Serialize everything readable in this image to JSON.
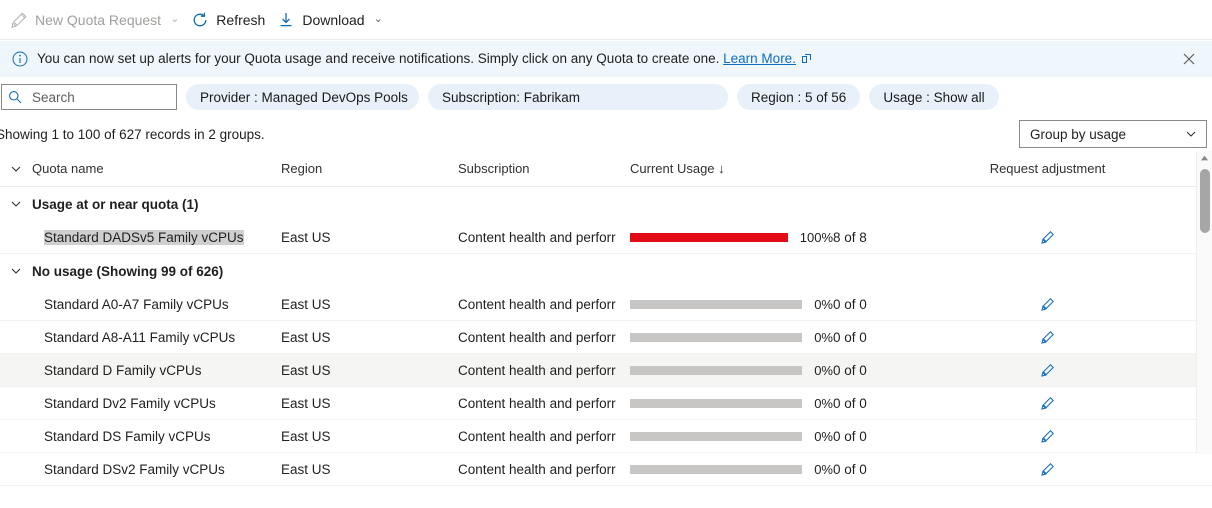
{
  "toolbar": {
    "new_quota_request": "New Quota Request",
    "refresh": "Refresh",
    "download": "Download"
  },
  "banner": {
    "text": "You can now set up alerts for your Quota usage and receive notifications. Simply click on any Quota to create one.",
    "link": "Learn More.",
    "background": "#eff6fc",
    "accent": "#0f6cbd"
  },
  "filters": {
    "search_placeholder": "Search",
    "search_value": "",
    "pills": [
      {
        "label": "Provider : Managed DevOps Pools"
      },
      {
        "label": "Subscription: Fabrikam"
      },
      {
        "label": "Region : 5 of 56"
      },
      {
        "label": "Usage : Show all"
      }
    ]
  },
  "meta": {
    "records": "Showing 1 to 100 of 627 records in 2 groups.",
    "group_by": "Group by usage"
  },
  "table": {
    "columns": {
      "quota_name": "Quota name",
      "region": "Region",
      "subscription": "Subscription",
      "current_usage": "Current Usage",
      "sort_indicator": "↓",
      "request_adjustment": "Request adjustment"
    },
    "groups": [
      {
        "title": "Usage at or near quota (1)",
        "rows": [
          {
            "name": "Standard DADSv5 Family vCPUs",
            "region": "East US",
            "subscription": "Content health and perforr",
            "percent": "100%",
            "percent_value": 100,
            "count": "8 of 8",
            "bar_color": "#e30b16",
            "selected": true,
            "hovered": false
          }
        ]
      },
      {
        "title": "No usage (Showing 99 of 626)",
        "rows": [
          {
            "name": "Standard A0-A7 Family vCPUs",
            "region": "East US",
            "subscription": "Content health and perforr",
            "percent": "0%",
            "percent_value": 0,
            "count": "0 of 0",
            "bar_color": "#c8c6c4",
            "selected": false,
            "hovered": false
          },
          {
            "name": "Standard A8-A11 Family vCPUs",
            "region": "East US",
            "subscription": "Content health and perforr",
            "percent": "0%",
            "percent_value": 0,
            "count": "0 of 0",
            "bar_color": "#c8c6c4",
            "selected": false,
            "hovered": false
          },
          {
            "name": "Standard D Family vCPUs",
            "region": "East US",
            "subscription": "Content health and perforr",
            "percent": "0%",
            "percent_value": 0,
            "count": "0 of 0",
            "bar_color": "#c8c6c4",
            "selected": false,
            "hovered": true
          },
          {
            "name": "Standard Dv2 Family vCPUs",
            "region": "East US",
            "subscription": "Content health and perforr",
            "percent": "0%",
            "percent_value": 0,
            "count": "0 of 0",
            "bar_color": "#c8c6c4",
            "selected": false,
            "hovered": false
          },
          {
            "name": "Standard DS Family vCPUs",
            "region": "East US",
            "subscription": "Content health and perforr",
            "percent": "0%",
            "percent_value": 0,
            "count": "0 of 0",
            "bar_color": "#c8c6c4",
            "selected": false,
            "hovered": false
          },
          {
            "name": "Standard DSv2 Family vCPUs",
            "region": "East US",
            "subscription": "Content health and perforr",
            "percent": "0%",
            "percent_value": 0,
            "count": "0 of 0",
            "bar_color": "#c8c6c4",
            "selected": false,
            "hovered": false
          }
        ]
      }
    ]
  },
  "icons": {
    "new_quota": "pencil-icon",
    "refresh": "refresh-icon",
    "download": "download-icon",
    "banner_info": "info-icon",
    "banner_external": "external-link-icon",
    "banner_close": "close-icon",
    "search": "search-icon",
    "group_by_chevron": "chevron-down-icon",
    "row_edit": "pencil-icon",
    "scroll_up": "chevron-up-icon"
  }
}
